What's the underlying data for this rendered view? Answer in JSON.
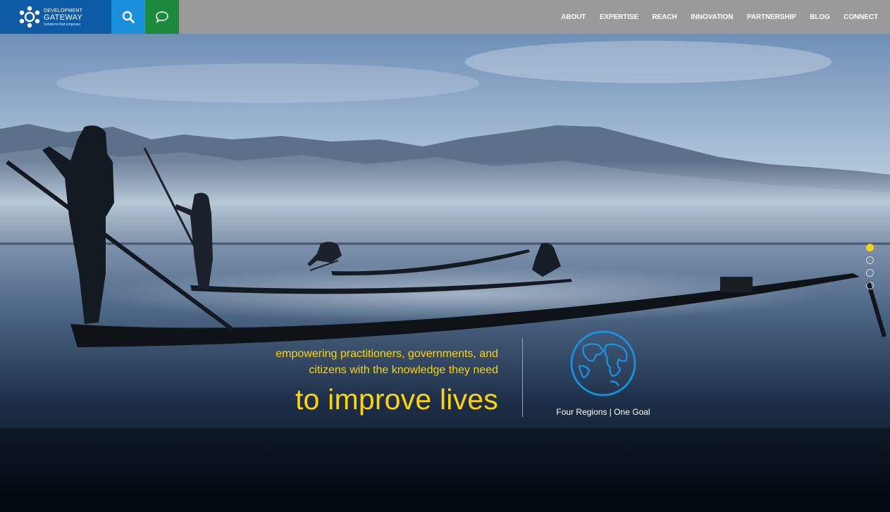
{
  "header": {
    "logo": {
      "line1": "DEVELOPMENT",
      "line2": "GATEWAY",
      "line3": "Solutions that empower"
    },
    "search_icon": "search-icon",
    "chat_icon": "chat-bubble-icon",
    "nav": [
      {
        "label": "ABOUT"
      },
      {
        "label": "EXPERTISE"
      },
      {
        "label": "REACH"
      },
      {
        "label": "INNOVATION"
      },
      {
        "label": "PARTNERSHIP"
      },
      {
        "label": "BLOG"
      },
      {
        "label": "CONNECT"
      }
    ],
    "colors": {
      "header_bg": "#9a9a9a",
      "logo_bg": "#0d5aa5",
      "search_bg": "#1a8fdc",
      "chat_bg": "#1e8a3d"
    }
  },
  "hero": {
    "tagline_line1": "empowering practitioners, governments, and",
    "tagline_line2": "citizens with the knowledge they need",
    "tagline_big": "to improve lives",
    "globe_icon": "globe-icon",
    "regions_caption": "Four Regions | One Goal",
    "slider": {
      "count": 4,
      "active_index": 0
    },
    "colors": {
      "tagline": "#ffd400",
      "globe": "#1a8fdc",
      "active_dot": "#f2d31c"
    }
  }
}
